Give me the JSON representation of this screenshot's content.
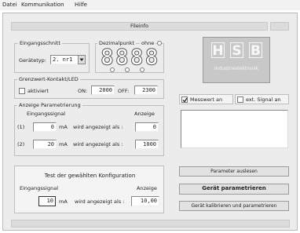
{
  "menu": {
    "file": "Datei",
    "comm": "Kommunikation",
    "help": "Hilfe"
  },
  "title": "Fileinfo",
  "interface": {
    "legend": "Eingangsschnitt",
    "device_label": "Gerätetyp:",
    "device_value": "2. nr1"
  },
  "decimal": {
    "legend": "Dezimalpunkt",
    "off_label": "ohne",
    "display": "8888"
  },
  "logo": {
    "letters": [
      "H",
      "S",
      "B"
    ],
    "subtitle": "Industrieelektronik"
  },
  "limit": {
    "legend": "Grenzwert-Kontakt/LED",
    "active_label": "aktiviert",
    "on_label": "ON:",
    "on_value": "2000",
    "off_label": "OFF:",
    "off_value": "2300"
  },
  "scaling": {
    "legend": "Anzeige Parametrierung",
    "col_input": "Eingangssignal",
    "col_display": "Anzeige",
    "rows": [
      {
        "index": "(1)",
        "input": "0",
        "unit": "mA",
        "text": "wird angezeigt als :",
        "display": "0"
      },
      {
        "index": "(2)",
        "input": "20",
        "unit": "mA",
        "text": "wird angezeigt als :",
        "display": "1000"
      }
    ]
  },
  "options": {
    "measure_label": "Messwert an",
    "ext_label": "ext. Signal an"
  },
  "test": {
    "title": "Test der gewählten Konfiguration",
    "col_input": "Eingangssignal",
    "col_display": "Anzeige",
    "input": "10",
    "unit": "mA",
    "text": "wird angezeigt als :",
    "display": "10,00"
  },
  "buttons": {
    "read": "Parameter auslesen",
    "program": "Gerät parametrieren",
    "calibrate": "Gerät kalibrieren und parametrieren"
  },
  "icons": {
    "dropdown": "chevron-down-icon",
    "check": "check-icon"
  }
}
